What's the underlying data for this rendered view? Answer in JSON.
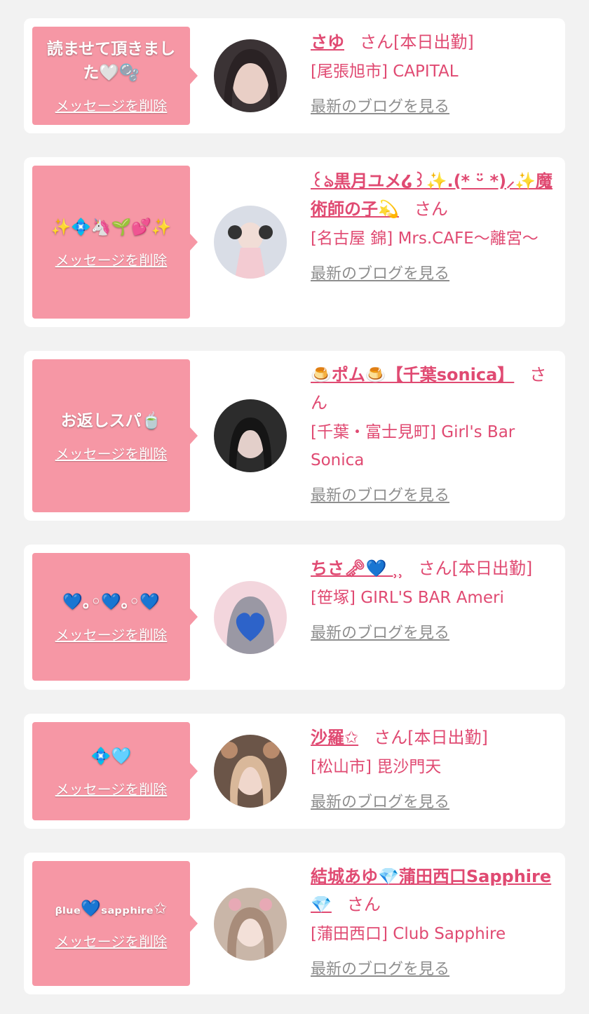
{
  "delete_label": "メッセージを削除",
  "blog_label": "最新のブログを見る",
  "honorific": "さん",
  "colors": {
    "bubble": "#f697a5",
    "name": "#e04a72",
    "link_gray": "#8e8e8e",
    "background": "#f2f2f2"
  },
  "cards": [
    {
      "message": "読ませて頂きました🤍🫧",
      "name": "さゆ",
      "status": "[本日出勤]",
      "shop": "[尾張旭市] CAPITAL"
    },
    {
      "message": "✨💠🦄🌱💕✨",
      "name": "꒰ঌ黒月ユメ໒꒱✨.(* ᵕ̈ *)⸝✨魔術師の子💫",
      "status": "",
      "shop": "[名古屋 錦] Mrs.CAFE〜離宮〜"
    },
    {
      "message": "お返しスパ🍵",
      "name": "🍮ポム🍮【千葉sonica】",
      "status": "",
      "shop": "[千葉・富士見町] Girl's Bar Sonica"
    },
    {
      "message": "💙｡◦💙｡◦💙",
      "name": "ちさ🗝💙 ⸒⸒",
      "status": "[本日出勤]",
      "shop": "[笹塚] GIRL'S BAR Ameri"
    },
    {
      "message": "💠🩵",
      "name": "沙羅✩",
      "status": "[本日出勤]",
      "shop": "[松山市] 毘沙門天"
    },
    {
      "message": "ᵦₗᵤₑ💙ₛₐₚₚₕᵢᵣₑ✩",
      "name": "結城あゆ💎蒲田西口Sapphire💎",
      "status": "",
      "shop": "[蒲田西口] Club Sapphire"
    }
  ]
}
